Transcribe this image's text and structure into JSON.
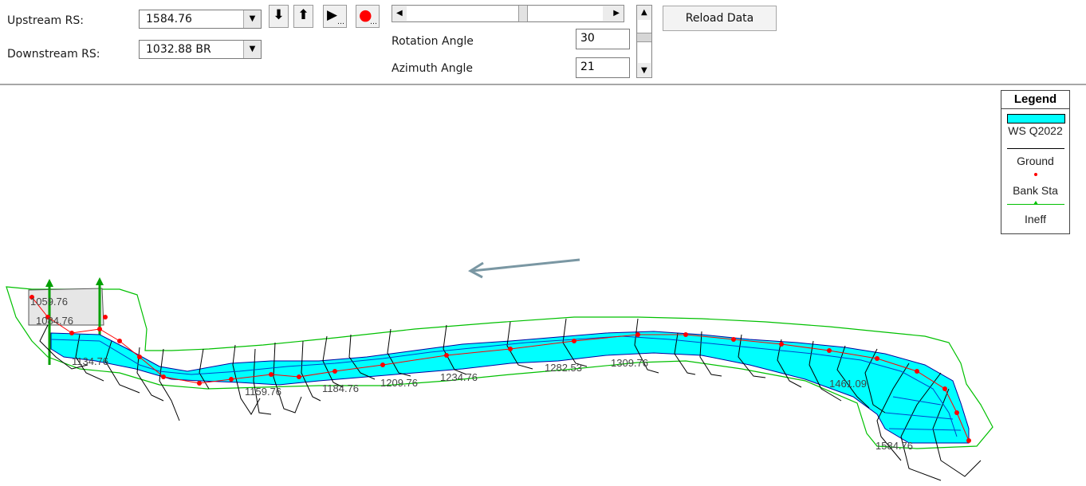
{
  "toolbar": {
    "upstream_label": "Upstream RS:",
    "upstream_value": "1584.76",
    "downstream_label": "Downstream RS:",
    "downstream_value": "1032.88 BR",
    "rotation_label": "Rotation Angle",
    "rotation_value": "30",
    "azimuth_label": "Azimuth Angle",
    "azimuth_value": "21",
    "reload_label": "Reload Data",
    "buttons": [
      {
        "icon": "arrow-down-icon",
        "glyph": "⬇"
      },
      {
        "icon": "arrow-up-icon",
        "glyph": "⬆"
      },
      {
        "icon": "play-icon",
        "glyph": "▶"
      },
      {
        "icon": "record-icon",
        "glyph": "●"
      }
    ]
  },
  "legend": {
    "title": "Legend",
    "items": [
      {
        "label": "WS Q2022",
        "color": "#00ffff"
      },
      {
        "label": "Ground",
        "color": "#000000"
      },
      {
        "label": "Bank Sta",
        "color": "#ff0000"
      },
      {
        "label": "Ineff",
        "color": "#00c000"
      }
    ]
  },
  "plot": {
    "station_labels": [
      "1059.76",
      "1084.76",
      "1134.76",
      "1159.76",
      "1184.76",
      "1209.76",
      "1234.76",
      "1282.53",
      "1309.76",
      "1461.09",
      "1584.76"
    ]
  },
  "colors": {
    "water": "#00ffff",
    "ground": "#000000",
    "bank": "#ff0000",
    "ineff": "#00c000",
    "arrow": "#7a97a3"
  }
}
